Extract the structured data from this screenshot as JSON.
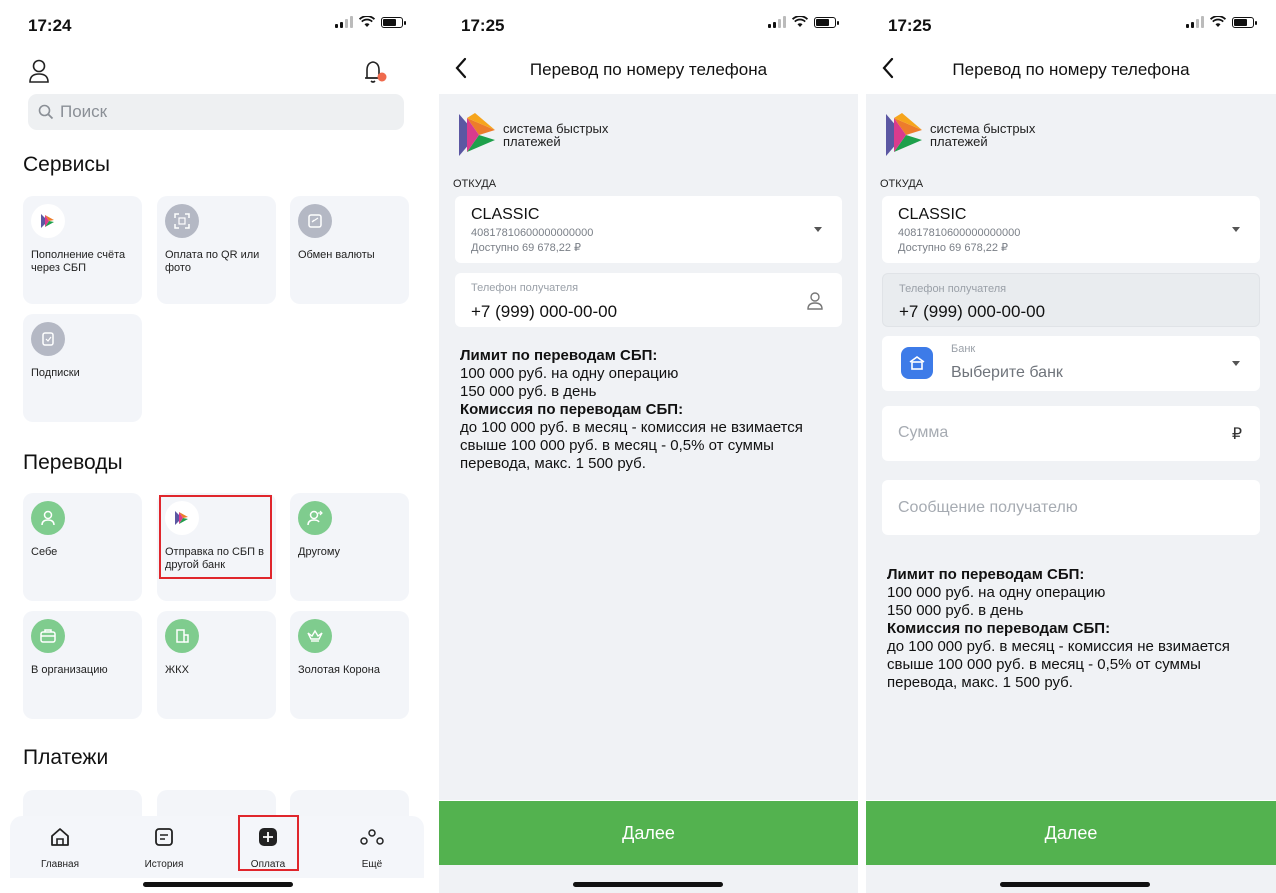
{
  "screen1": {
    "time": "17:24",
    "search_placeholder": "Поиск",
    "services_title": "Сервисы",
    "services": [
      {
        "label": "Пополнение счёта через СБП",
        "icon": "sbp-logo-icon"
      },
      {
        "label": "Оплата по QR или фото",
        "icon": "qr-scan-icon"
      },
      {
        "label": "Обмен валюты",
        "icon": "currency-exchange-icon"
      },
      {
        "label": "Подписки",
        "icon": "subscriptions-icon"
      }
    ],
    "transfers_title": "Переводы",
    "transfers": [
      {
        "label": "Себе",
        "icon": "person-icon"
      },
      {
        "label": "Отправка по СБП в другой банк",
        "icon": "sbp-logo-icon"
      },
      {
        "label": "Другому",
        "icon": "person-arrow-icon"
      },
      {
        "label": "В организацию",
        "icon": "briefcase-icon"
      },
      {
        "label": "ЖКХ",
        "icon": "building-icon"
      },
      {
        "label": "Золотая Корона",
        "icon": "crown-icon"
      }
    ],
    "payments_title": "Платежи",
    "tabs": [
      {
        "label": "Главная",
        "icon": "home-icon"
      },
      {
        "label": "История",
        "icon": "history-icon"
      },
      {
        "label": "Оплата",
        "icon": "plus-icon"
      },
      {
        "label": "Ещё",
        "icon": "more-icon"
      }
    ],
    "highlight_color": "#e0262c"
  },
  "screen2": {
    "time": "17:25",
    "title": "Перевод по номеру телефона",
    "sbp_line1": "система быстрых",
    "sbp_line2": "платежей",
    "from_label": "ОТКУДА",
    "card_name": "CLASSIC",
    "card_number": "40817810600000000000",
    "card_available": "Доступно 69 678,22 ₽",
    "phone_label": "Телефон получателя",
    "phone_value": "+7 (999) 000-00-00",
    "info_title1": "Лимит по переводам СБП:",
    "info_line1": "100 000 руб. на одну операцию",
    "info_line2": "150 000 руб. в день",
    "info_title2": "Комиссия по переводам СБП:",
    "info_line3": "до 100 000 руб. в месяц - комиссия не взимается",
    "info_line4": "свыше 100 000 руб. в месяц - 0,5% от суммы перевода, макс. 1 500 руб.",
    "next_label": "Далее",
    "accent": "#53b24f"
  },
  "screen3": {
    "time": "17:25",
    "title": "Перевод по номеру телефона",
    "sbp_line1": "система быстрых",
    "sbp_line2": "платежей",
    "from_label": "ОТКУДА",
    "card_name": "CLASSIC",
    "card_number": "40817810600000000000",
    "card_available": "Доступно 69 678,22 ₽",
    "phone_label": "Телефон получателя",
    "phone_value": "+7 (999) 000-00-00",
    "bank_label": "Банк",
    "bank_placeholder": "Выберите банк",
    "amount_placeholder": "Сумма",
    "currency": "₽",
    "message_placeholder": "Сообщение получателю",
    "info_title1": "Лимит по переводам СБП:",
    "info_line1": "100 000 руб. на одну операцию",
    "info_line2": "150 000 руб. в день",
    "info_title2": "Комиссия по переводам СБП:",
    "info_line3": "до 100 000 руб. в месяц - комиссия не взимается",
    "info_line4": "свыше 100 000 руб. в месяц - 0,5% от суммы перевода, макс. 1 500 руб.",
    "next_label": "Далее"
  }
}
